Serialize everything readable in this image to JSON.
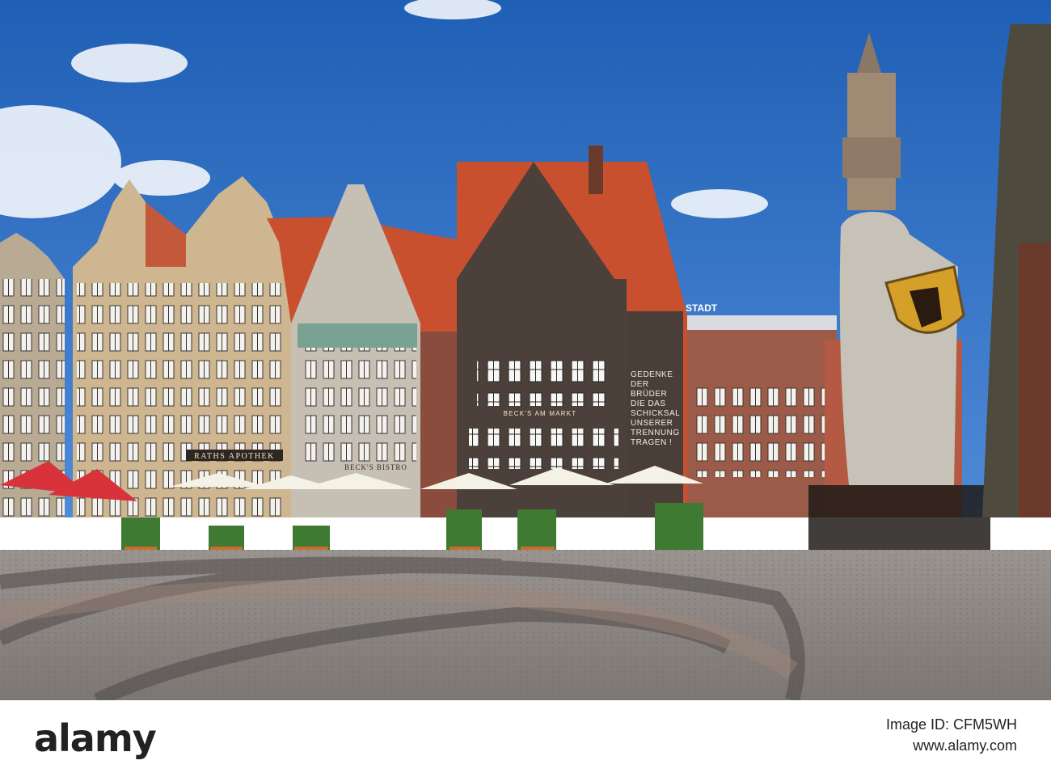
{
  "photo": {
    "signs": {
      "raths_apotheke": "RATHS APOTHEK",
      "becks_bistro": "BECK'S BISTRO",
      "becks_am_markt": "BECK'S AM MARKT",
      "galeria_stadt": "STADT",
      "inscription": [
        "GEDENKE",
        "DER",
        "BRÜDER",
        "DIE DAS",
        "SCHICKSAL",
        "UNSERER",
        "TRENNUNG",
        "TRAGEN !"
      ]
    }
  },
  "footer": {
    "brand": "alamy",
    "image_id_label": "Image ID: CFM5WH",
    "url": "www.alamy.com"
  },
  "colors": {
    "sky": "#1f5fb5",
    "roof": "#c9502f",
    "brick": "#5a4a44",
    "sandstone": "#c9b28a",
    "pavement": "#8f8884",
    "footer_text": "#222222"
  }
}
